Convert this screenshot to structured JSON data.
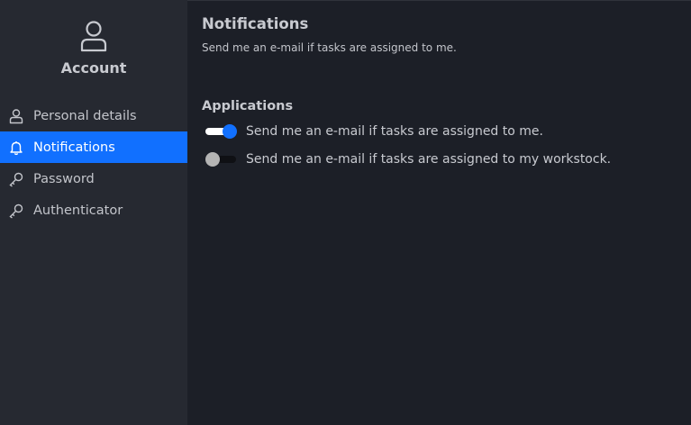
{
  "sidebar": {
    "account_label": "Account",
    "account_icon": "user-icon",
    "items": [
      {
        "label": "Personal details",
        "icon": "user-icon",
        "active": false
      },
      {
        "label": "Notifications",
        "icon": "bell-icon",
        "active": true
      },
      {
        "label": "Password",
        "icon": "key-icon",
        "active": false
      },
      {
        "label": "Authenticator",
        "icon": "key-icon",
        "active": false
      }
    ]
  },
  "main": {
    "title": "Notifications",
    "description": "Send me an e-mail if tasks are assigned to me.",
    "section_title": "Applications",
    "toggles": [
      {
        "label": "Send me an e-mail if tasks are assigned to me.",
        "checked": true
      },
      {
        "label": "Send me an e-mail if tasks are assigned to my workstock.",
        "checked": false
      }
    ]
  },
  "colors": {
    "accent": "#1170ff",
    "sidebar_bg": "#262931",
    "main_bg": "#1c1f27"
  }
}
